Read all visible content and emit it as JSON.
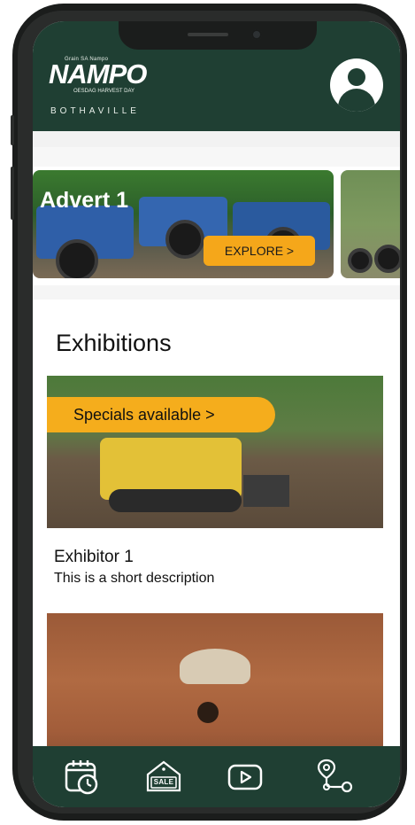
{
  "header": {
    "logo_brand": "NAMPO",
    "logo_tagline_top": "Grain SA Nampo",
    "logo_tagline_sub": "OESDAG HARVEST DAY",
    "logo_location": "BOTHAVILLE"
  },
  "carousel": {
    "cards": [
      {
        "title": "Advert 1",
        "button_label": "EXPLORE >"
      },
      {
        "title": ""
      }
    ]
  },
  "exhibitions": {
    "section_title": "Exhibitions",
    "items": [
      {
        "badge": "Specials available >",
        "name": "Exhibitor 1",
        "description": "This is a short description"
      },
      {
        "badge": "",
        "name": "",
        "description": ""
      }
    ]
  },
  "bottom_nav": {
    "items": [
      {
        "icon": "calendar-clock-icon"
      },
      {
        "icon": "sale-tag-icon",
        "label": "SALE"
      },
      {
        "icon": "video-play-icon"
      },
      {
        "icon": "route-map-icon"
      }
    ]
  },
  "colors": {
    "brand_green": "#1f3f33",
    "accent_orange": "#f5a71a"
  }
}
